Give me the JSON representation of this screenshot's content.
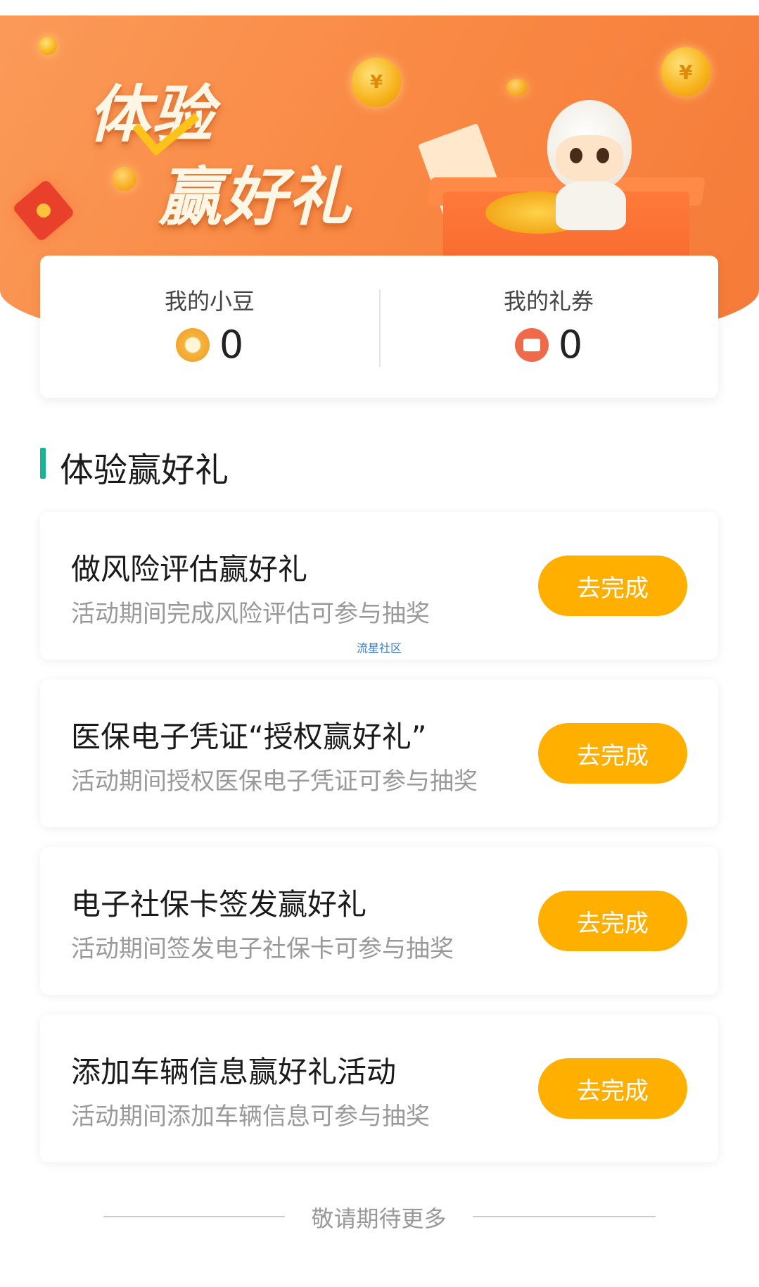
{
  "banner": {
    "title_line1": "体验",
    "title_line2": "赢好礼",
    "coin_symbol": "¥"
  },
  "assets": {
    "beans": {
      "label": "我的小豆",
      "value": "0",
      "icon": "bean-icon"
    },
    "coupons": {
      "label": "我的礼券",
      "value": "0",
      "icon": "coupon-icon"
    }
  },
  "section": {
    "title": "体验赢好礼",
    "accent_color": "#1ab394"
  },
  "tasks": [
    {
      "title": "做风险评估赢好礼",
      "desc": "活动期间完成风险评估可参与抽奖",
      "button": "去完成"
    },
    {
      "title": "医保电子凭证“授权赢好礼”",
      "desc": "活动期间授权医保电子凭证可参与抽奖",
      "button": "去完成"
    },
    {
      "title": "电子社保卡签发赢好礼",
      "desc": "活动期间签发电子社保卡可参与抽奖",
      "button": "去完成"
    },
    {
      "title": "添加车辆信息赢好礼活动",
      "desc": "活动期间添加车辆信息可参与抽奖",
      "button": "去完成"
    }
  ],
  "watermark": "流星社区",
  "footer": {
    "text": "敬请期待更多"
  },
  "colors": {
    "banner": "#f98a45",
    "button": "#ffaf00"
  }
}
